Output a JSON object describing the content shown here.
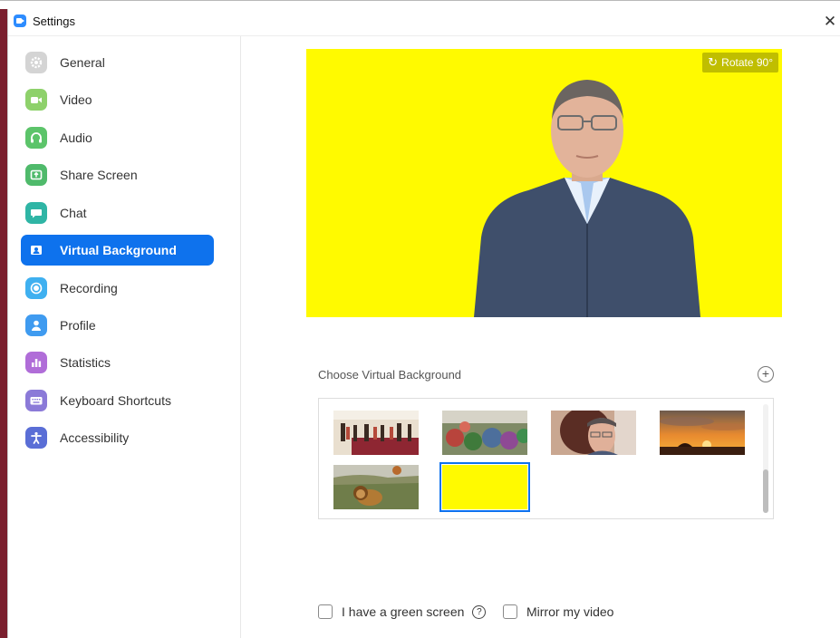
{
  "window": {
    "title": "Settings",
    "close_glyph": "✕"
  },
  "sidebar": {
    "items": [
      {
        "label": "General",
        "icon": "gear-icon",
        "color": "#c9c9c9"
      },
      {
        "label": "Video",
        "icon": "video-camera-icon",
        "color": "#8ed16b"
      },
      {
        "label": "Audio",
        "icon": "headphones-icon",
        "color": "#5cc46a"
      },
      {
        "label": "Share Screen",
        "icon": "share-screen-icon",
        "color": "#4fba6b"
      },
      {
        "label": "Chat",
        "icon": "chat-bubble-icon",
        "color": "#2fb5a5"
      },
      {
        "label": "Virtual Background",
        "icon": "virtual-background-icon",
        "color": "#0e72ed",
        "active": true
      },
      {
        "label": "Recording",
        "icon": "record-icon",
        "color": "#3fb0f0"
      },
      {
        "label": "Profile",
        "icon": "profile-icon",
        "color": "#3f9bf0"
      },
      {
        "label": "Statistics",
        "icon": "statistics-icon",
        "color": "#b06dd8"
      },
      {
        "label": "Keyboard Shortcuts",
        "icon": "keyboard-icon",
        "color": "#8b7ad8"
      },
      {
        "label": "Accessibility",
        "icon": "accessibility-icon",
        "color": "#5a6ed6"
      }
    ]
  },
  "preview": {
    "rotate_label": "Rotate 90°",
    "background_color": "#fffa00"
  },
  "backgrounds": {
    "heading": "Choose Virtual Background",
    "add_glyph": "+",
    "thumbnails": [
      {
        "name": "ballroom"
      },
      {
        "name": "flower-market"
      },
      {
        "name": "self-portrait"
      },
      {
        "name": "sunset"
      },
      {
        "name": "lion-savanna"
      },
      {
        "name": "yellow",
        "selected": true
      }
    ]
  },
  "options": {
    "green_screen_label": "I have a green screen",
    "help_glyph": "?",
    "mirror_label": "Mirror my video"
  },
  "colors": {
    "accent": "#0e72ed",
    "preview_yellow": "#fffa00"
  }
}
